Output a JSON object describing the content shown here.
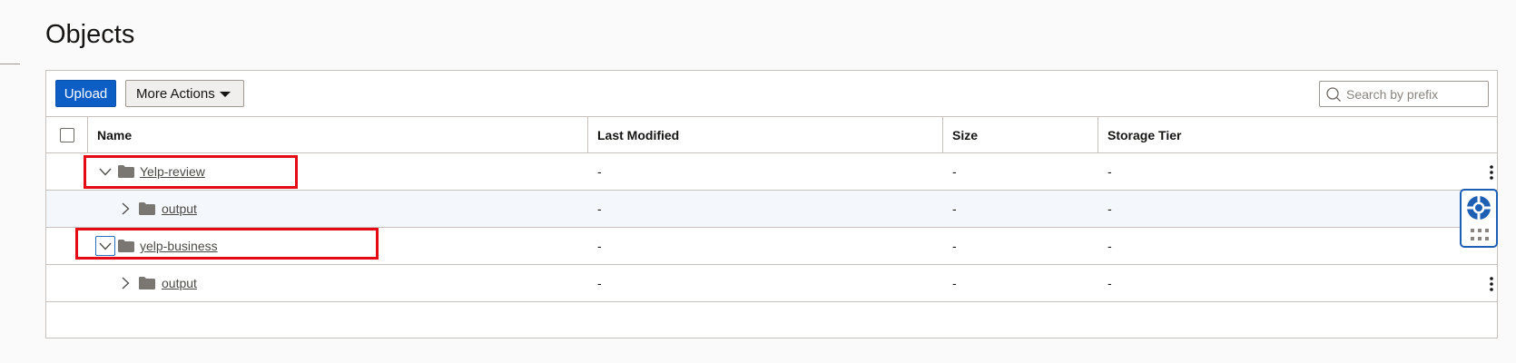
{
  "page": {
    "title": "Objects"
  },
  "toolbar": {
    "upload_label": "Upload",
    "more_actions_label": "More Actions"
  },
  "search": {
    "placeholder": "Search by prefix",
    "value": ""
  },
  "table": {
    "columns": {
      "name": "Name",
      "last_modified": "Last Modified",
      "size": "Size",
      "storage_tier": "Storage Tier"
    },
    "rows": [
      {
        "name": "Yelp-review",
        "level": 0,
        "expanded": true,
        "last_modified": "-",
        "size": "-",
        "storage_tier": "-"
      },
      {
        "name": "output",
        "level": 1,
        "expanded": false,
        "last_modified": "-",
        "size": "-",
        "storage_tier": "-"
      },
      {
        "name": "yelp-business",
        "level": 0,
        "expanded": true,
        "last_modified": "-",
        "size": "-",
        "storage_tier": "-"
      },
      {
        "name": "output",
        "level": 1,
        "expanded": false,
        "last_modified": "-",
        "size": "-",
        "storage_tier": "-"
      }
    ]
  },
  "icons": {
    "folder": "folder-icon",
    "expand": "chevron-down-icon",
    "collapse": "chevron-right-icon",
    "search": "search-icon",
    "menu": "kebab-icon",
    "help": "lifebuoy-icon",
    "apps": "grid-icon"
  },
  "colors": {
    "primary": "#0d5ec4",
    "highlight": "#e40914",
    "folder": "#7a7672"
  }
}
